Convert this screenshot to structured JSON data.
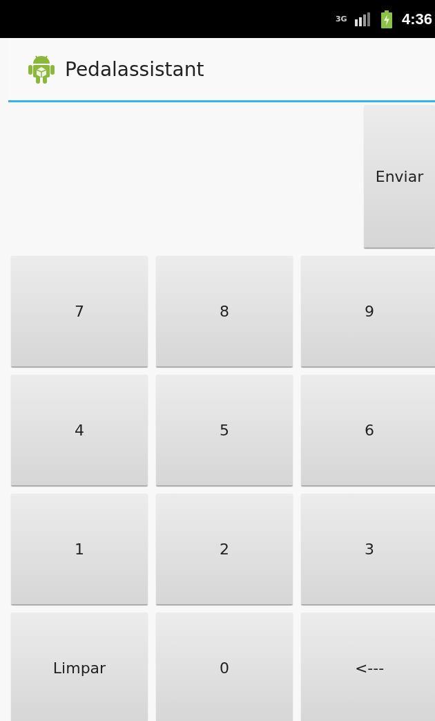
{
  "status_bar": {
    "network": "3G",
    "time": "4:36"
  },
  "app_bar": {
    "title": "Pedalassistant"
  },
  "send_button": {
    "label": "Enviar"
  },
  "keypad": [
    {
      "label": "7"
    },
    {
      "label": "8"
    },
    {
      "label": "9"
    },
    {
      "label": "4"
    },
    {
      "label": "5"
    },
    {
      "label": "6"
    },
    {
      "label": "1"
    },
    {
      "label": "2"
    },
    {
      "label": "3"
    },
    {
      "label": "Limpar"
    },
    {
      "label": "0"
    },
    {
      "label": "<---"
    }
  ]
}
